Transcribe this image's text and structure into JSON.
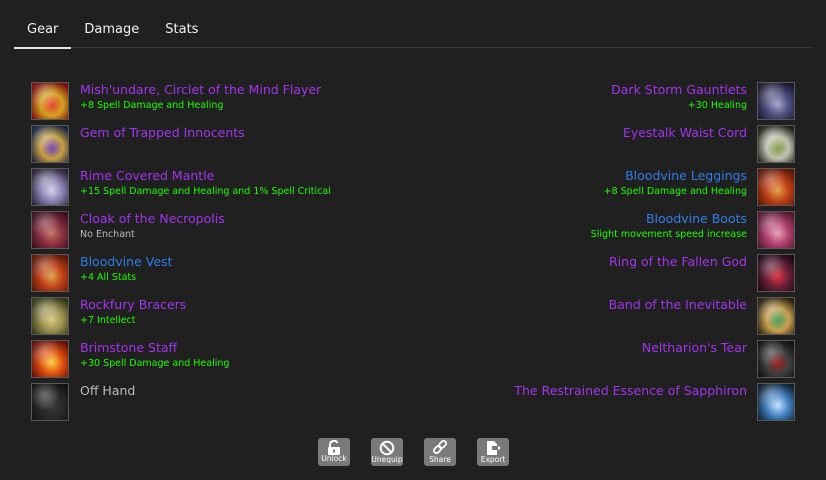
{
  "tabs": [
    "Gear",
    "Damage",
    "Stats"
  ],
  "left_slots": [
    {
      "name": "Mish'undare, Circlet of the Mind Flayer",
      "enchant": "+8 Spell Damage and Healing",
      "quality": "epic",
      "enchant_color": "green",
      "icon": "mind-flayer-circlet-icon",
      "colors": [
        "#7a1010",
        "#d4a020",
        "#e84030"
      ]
    },
    {
      "name": "Gem of Trapped Innocents",
      "enchant": "",
      "quality": "epic",
      "enchant_color": "green",
      "icon": "gold-necklace-icon",
      "colors": [
        "#1a2440",
        "#c8a040",
        "#7040c0"
      ]
    },
    {
      "name": "Rime Covered Mantle",
      "enchant": "+15 Spell Damage and Healing and 1% Spell Critical",
      "quality": "epic",
      "enchant_color": "green",
      "icon": "frost-mantle-icon",
      "colors": [
        "#2a2438",
        "#8a80b0",
        "#d0d0e8"
      ]
    },
    {
      "name": "Cloak of the Necropolis",
      "enchant": "No Enchant",
      "quality": "epic",
      "enchant_color": "grey",
      "icon": "necropolis-cloak-icon",
      "colors": [
        "#3a1020",
        "#8a3040",
        "#c07060"
      ]
    },
    {
      "name": "Bloodvine Vest",
      "enchant": "+4 All Stats",
      "quality": "rare",
      "enchant_color": "green",
      "icon": "bloodvine-vest-icon",
      "colors": [
        "#5a1808",
        "#c04018",
        "#e0a040"
      ]
    },
    {
      "name": "Rockfury Bracers",
      "enchant": "+7 Intellect",
      "quality": "epic",
      "enchant_color": "green",
      "icon": "bracers-icon",
      "colors": [
        "#303818",
        "#9a9050",
        "#d8c880"
      ]
    },
    {
      "name": "Brimstone Staff",
      "enchant": "+30 Spell Damage and Healing",
      "quality": "epic",
      "enchant_color": "green",
      "icon": "fire-staff-icon",
      "colors": [
        "#601008",
        "#e05010",
        "#ffd040"
      ]
    },
    {
      "name": "Off Hand",
      "enchant": "",
      "quality": "empty",
      "enchant_color": "grey",
      "icon": "empty-offhand-slot-icon",
      "colors": [
        "#141414",
        "#2a2a2a",
        "#3a3a3a"
      ]
    }
  ],
  "right_slots": [
    {
      "name": "Dark Storm Gauntlets",
      "enchant": "+30 Healing",
      "quality": "epic",
      "enchant_color": "green",
      "icon": "gauntlets-icon",
      "colors": [
        "#181830",
        "#505080",
        "#a0a0c8"
      ]
    },
    {
      "name": "Eyestalk Waist Cord",
      "enchant": "",
      "quality": "epic",
      "enchant_color": "green",
      "icon": "waist-cord-icon",
      "colors": [
        "#202018",
        "#c0c0b0",
        "#80a040"
      ]
    },
    {
      "name": "Bloodvine Leggings",
      "enchant": "+8 Spell Damage and Healing",
      "quality": "rare",
      "enchant_color": "green",
      "icon": "bloodvine-leggings-icon",
      "colors": [
        "#5a1808",
        "#c04018",
        "#e0a040"
      ]
    },
    {
      "name": "Bloodvine Boots",
      "enchant": "Slight movement speed increase",
      "quality": "rare",
      "enchant_color": "green",
      "icon": "bloodvine-boots-icon",
      "colors": [
        "#501830",
        "#b04070",
        "#e8a0b0"
      ]
    },
    {
      "name": "Ring of the Fallen God",
      "enchant": "",
      "quality": "epic",
      "enchant_color": "green",
      "icon": "red-ring-icon",
      "colors": [
        "#200818",
        "#6a2038",
        "#e03040"
      ]
    },
    {
      "name": "Band of the Inevitable",
      "enchant": "",
      "quality": "epic",
      "enchant_color": "green",
      "icon": "gold-band-icon",
      "colors": [
        "#282010",
        "#c8a050",
        "#40a060"
      ]
    },
    {
      "name": "Neltharion's Tear",
      "enchant": "",
      "quality": "epic",
      "enchant_color": "green",
      "icon": "black-gem-icon",
      "colors": [
        "#101010",
        "#404040",
        "#a02020"
      ]
    },
    {
      "name": "The Restrained Essence of Sapphiron",
      "enchant": "",
      "quality": "epic",
      "enchant_color": "green",
      "icon": "sapphiron-essence-icon",
      "colors": [
        "#102030",
        "#4080c0",
        "#c0e0ff"
      ]
    }
  ],
  "actions": [
    {
      "label": "Unlock",
      "icon": "unlock-icon"
    },
    {
      "label": "Unequip",
      "icon": "unequip-icon"
    },
    {
      "label": "Share",
      "icon": "share-link-icon"
    },
    {
      "label": "Export",
      "icon": "export-icon"
    }
  ]
}
